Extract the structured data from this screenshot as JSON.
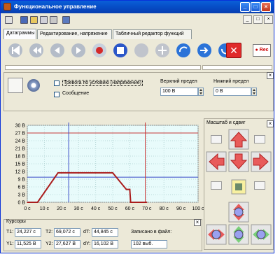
{
  "window": {
    "title": "Функциональное управление"
  },
  "tabs": [
    "Датаграммы",
    "Редактирование, напряжение",
    "Табличный редактор функций"
  ],
  "toolbar": {
    "rec_label": "Rec"
  },
  "alarm": {
    "checkbox1_label": "Тревога по условию (напряжение)",
    "checkbox2_label": "Сообщение",
    "upper_label": "Верхний предел",
    "upper_value": "100 В",
    "lower_label": "Нижний предел",
    "lower_value": "0 В"
  },
  "chart_data": {
    "type": "line",
    "y_ticks": [
      "30 В",
      "27 В",
      "24 В",
      "21 В",
      "18 В",
      "15 В",
      "12 В",
      "9 В",
      "6 В",
      "3 В",
      "0 В"
    ],
    "x_ticks": [
      "0 с",
      "10 с",
      "20 с",
      "30 с",
      "40 с",
      "50 с",
      "60 с",
      "70 с",
      "80 с",
      "90 с",
      "100 с"
    ],
    "ylim": [
      0,
      30
    ],
    "xlim": [
      0,
      100
    ],
    "x": [
      0,
      6,
      18,
      20,
      30,
      40,
      50,
      58,
      60,
      60.5,
      70
    ],
    "y": [
      0,
      0,
      11.5,
      11.5,
      11.5,
      11.5,
      11.5,
      5,
      5,
      0,
      0
    ],
    "cursor1_x": 24.227,
    "cursor2_x": 69.072,
    "ref_high": 27,
    "ref_low": 9.8,
    "colors": {
      "trace": "#aa1c1c",
      "ref_high": "#c83a3a",
      "ref_low": "#3a4bc8",
      "cursor1": "#3a4bc8",
      "cursor2": "#c83a3a",
      "bg": "#e8fbfb"
    }
  },
  "scale_panel": {
    "title": "Масштаб и сдвиг"
  },
  "cursors": {
    "title": "Курсоры",
    "t1_label": "T1:",
    "t1_value": "24,227 с",
    "t2_label": "T2:",
    "t2_value": "69,072 с",
    "dt_label": "dT:",
    "dt_value": "44,845 с",
    "y1_label": "Y1:",
    "y1_value": "11,525 В",
    "y2_label": "Y2:",
    "y2_value": "27,627 В",
    "dy_label": "dY:",
    "dy_value": "16,102 В",
    "saved_label": "Записано в файл:",
    "saved_value": "102 выб."
  }
}
